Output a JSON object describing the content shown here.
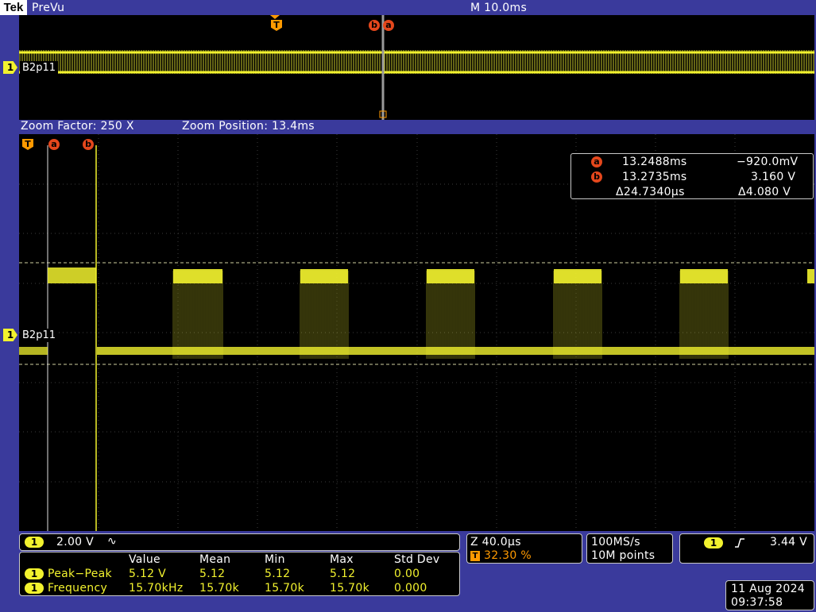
{
  "header": {
    "logo": "Tek",
    "mode": "PreVu",
    "timebase": "M 10.0ms"
  },
  "overview": {
    "channel_marker": "1",
    "channel_label": "B2p11",
    "trigger_marker": "T",
    "cursor_b": "b",
    "cursor_a": "a"
  },
  "zoom": {
    "factor": "Zoom Factor: 250 X",
    "position": "Zoom Position: 13.4ms"
  },
  "main_display": {
    "trigger_marker": "T",
    "cursor_a": "a",
    "cursor_b": "b",
    "channel_marker": "1",
    "channel_label": "B2p11"
  },
  "cursor_readout": {
    "a_label": "a",
    "a_time": "13.2488ms",
    "a_value": "−920.0mV",
    "b_label": "b",
    "b_time": "13.2735ms",
    "b_value": "3.160 V",
    "delta_time": "Δ24.7340µs",
    "delta_value": "Δ4.080 V"
  },
  "channel_settings": {
    "channel": "1",
    "scale": "2.00 V",
    "coupling_icon": "∿"
  },
  "measurements": {
    "headers": [
      "Value",
      "Mean",
      "Min",
      "Max",
      "Std Dev"
    ],
    "rows": [
      {
        "channel": "1",
        "name": "Peak−Peak",
        "values": [
          "5.12 V",
          "5.12",
          "5.12",
          "5.12",
          "0.00"
        ]
      },
      {
        "channel": "1",
        "name": "Frequency",
        "values": [
          "15.70kHz",
          "15.70k",
          "15.70k",
          "15.70k",
          "0.000"
        ]
      }
    ]
  },
  "horizontal": {
    "zoom_scale": "Z 40.0µs",
    "trigger_marker": "T",
    "trigger_position": "32.30 %"
  },
  "acquisition": {
    "sample_rate": "100MS/s",
    "record_length": "10M points"
  },
  "trigger": {
    "channel": "1",
    "slope_icon": "rising-edge-icon",
    "level": "3.44 V"
  },
  "datetime": {
    "date": "11 Aug 2024",
    "time": "09:37:58"
  },
  "colors": {
    "channel1": "#f2f22e",
    "trigger": "#ff9a00",
    "cursor": "#e4471c",
    "frame": "#3a3a9c",
    "screen": "#000000"
  },
  "waveform": {
    "bursts_count": 5,
    "high_level_v": 3.16,
    "low_level_v": -0.92
  }
}
